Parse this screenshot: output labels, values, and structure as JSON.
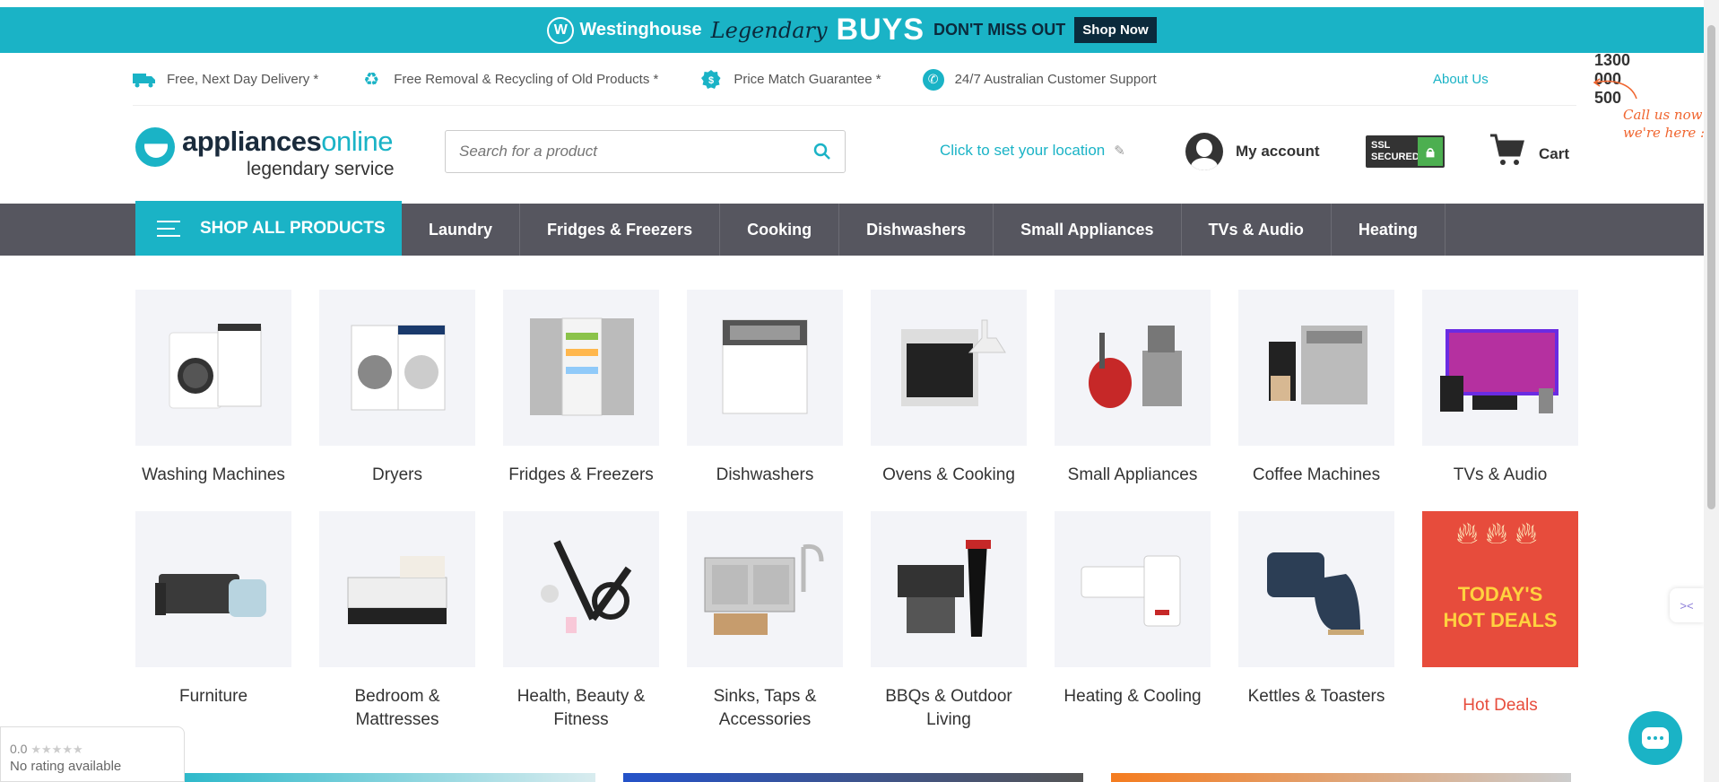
{
  "promo": {
    "brand": "Westinghouse",
    "legendary": "Legendary",
    "buys": "BUYS",
    "dont_miss": "DON'T MISS OUT",
    "shop_now": "Shop Now"
  },
  "usp": [
    {
      "icon": "truck-icon",
      "text": "Free, Next Day Delivery *"
    },
    {
      "icon": "recycle-icon",
      "text": "Free Removal & Recycling of Old Products *"
    },
    {
      "icon": "price-tag-icon",
      "text": "Price Match Guarantee *"
    },
    {
      "icon": "phone-icon",
      "text": "24/7 Australian Customer Support"
    }
  ],
  "header": {
    "about": "About Us",
    "phone": "1300 000 500",
    "call_note_line1": "Call us now",
    "call_note_line2": "we're here :",
    "logo_main": "appliances",
    "logo_accent": "online",
    "logo_tagline": "legendary service",
    "search_placeholder": "Search for a product",
    "location": "Click to set your location",
    "account": "My account",
    "ssl_line1": "SSL",
    "ssl_line2": "SECURED",
    "cart": "Cart"
  },
  "nav": {
    "shop_all": "SHOP ALL PRODUCTS",
    "items": [
      "Laundry",
      "Fridges & Freezers",
      "Cooking",
      "Dishwashers",
      "Small Appliances",
      "TVs & Audio",
      "Heating"
    ]
  },
  "categories": [
    {
      "label": "Washing Machines"
    },
    {
      "label": "Dryers"
    },
    {
      "label": "Fridges & Freezers"
    },
    {
      "label": "Dishwashers"
    },
    {
      "label": "Ovens & Cooking"
    },
    {
      "label": "Small Appliances"
    },
    {
      "label": "Coffee Machines"
    },
    {
      "label": "TVs & Audio"
    },
    {
      "label": "Furniture"
    },
    {
      "label": "Bedroom & Mattresses"
    },
    {
      "label": "Health, Beauty & Fitness"
    },
    {
      "label": "Sinks, Taps & Accessories"
    },
    {
      "label": "BBQs & Outdoor Living"
    },
    {
      "label": "Heating & Cooling"
    },
    {
      "label": "Kettles & Toasters"
    },
    {
      "label": "Hot Deals"
    }
  ],
  "hot_deals": {
    "line1": "TODAY'S",
    "line2": "HOT DEALS"
  },
  "rating": {
    "score": "0.0",
    "stars": "★★★★★",
    "text": "No rating available"
  },
  "colors": {
    "brand": "#1ab3c6",
    "nav": "#56565f",
    "hot": "#e74c3c",
    "call_note": "#f0652f"
  }
}
